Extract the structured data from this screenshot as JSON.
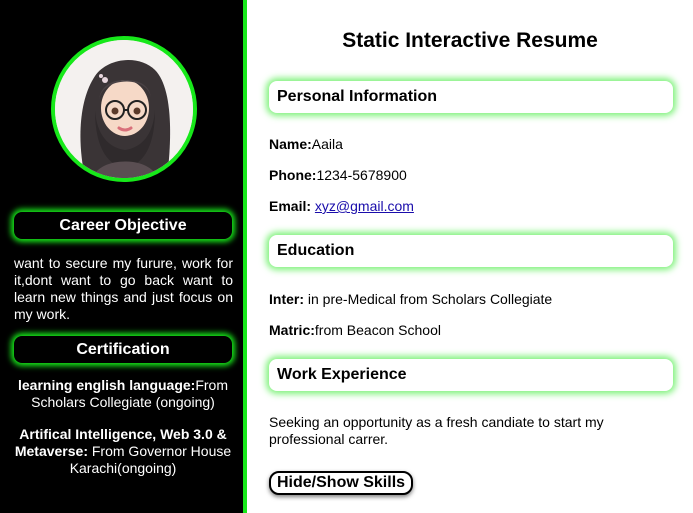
{
  "colors": {
    "accent": "#17e81a",
    "sidebar_bg": "#000000",
    "glow": "#7ef27a"
  },
  "sidebar": {
    "avatar_icon": "hijab-girl-avatar",
    "career_heading": "Career Objective",
    "career_text": "want to secure my furure, work for it,dont want to go back want to learn new things and just focus on my work.",
    "certification_heading": "Certification",
    "certifications": [
      {
        "title": "learning english language:",
        "detail": "From Scholars Collegiate (ongoing)"
      },
      {
        "title": "Artifical Intelligence, Web 3.0 & Metaverse:",
        "detail": " From Governor House Karachi(ongoing)"
      }
    ]
  },
  "main": {
    "title": "Static Interactive Resume",
    "personal": {
      "heading": "Personal Information",
      "name_label": "Name:",
      "name_value": "Aaila",
      "phone_label": "Phone:",
      "phone_value": "1234-5678900",
      "email_label": "Email:",
      "email_value": "xyz@gmail.com"
    },
    "education": {
      "heading": "Education",
      "inter_label": "Inter:",
      "inter_value": " in pre-Medical from Scholars Collegiate",
      "matric_label": "Matric:",
      "matric_value": "from Beacon School"
    },
    "work": {
      "heading": "Work Experience",
      "text": "Seeking an opportunity as a fresh candiate to start my professional carrer."
    },
    "toggle_button": "Hide/Show Skills"
  }
}
